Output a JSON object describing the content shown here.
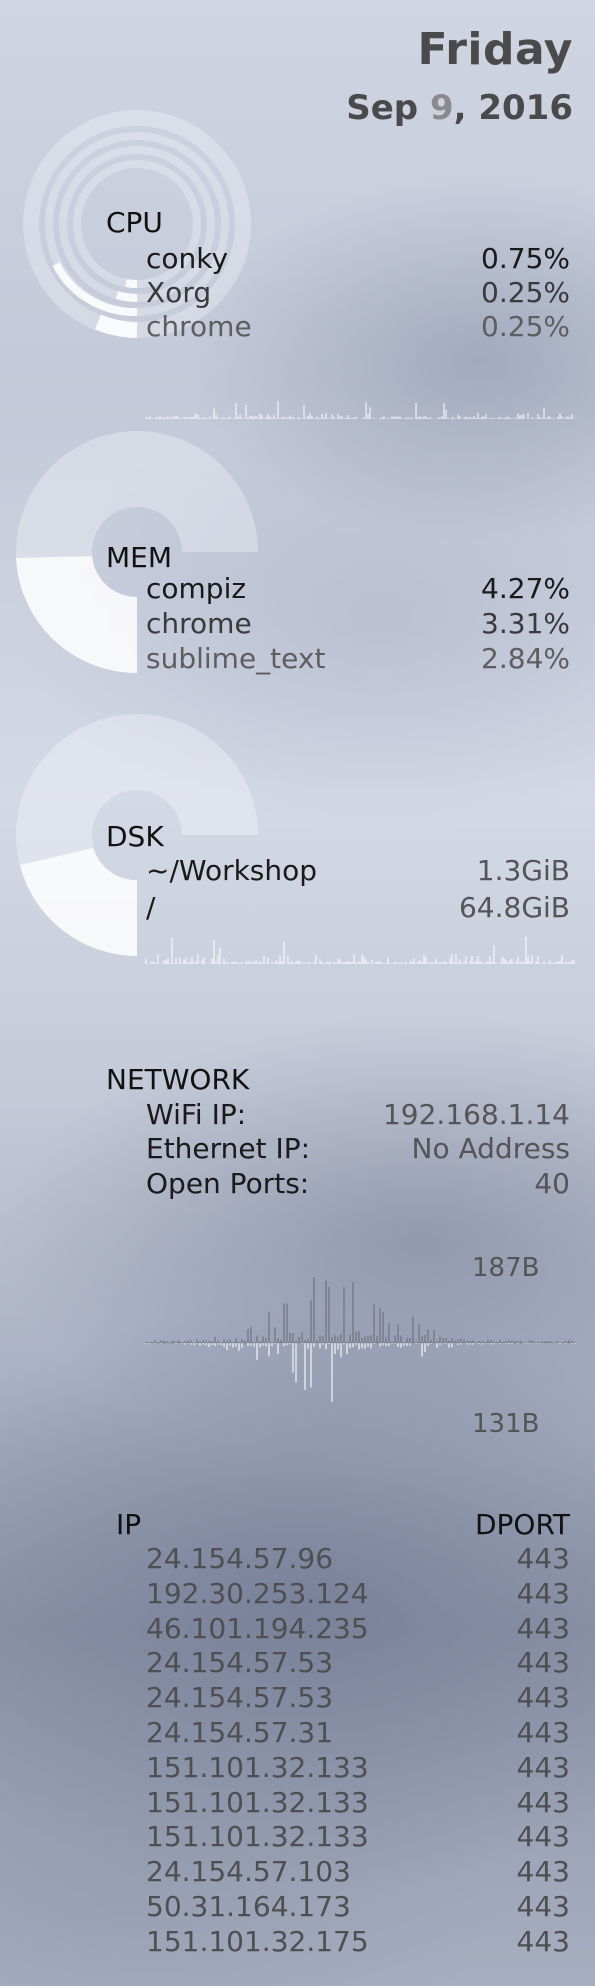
{
  "date": {
    "day": "Friday",
    "month": "Sep",
    "day_num": "9",
    "year_suffix": ", 2016"
  },
  "cpu": {
    "label": "CPU",
    "usage_fraction": 0.0075,
    "processes": [
      {
        "name": "conky",
        "value": "0.75%"
      },
      {
        "name": "Xorg",
        "value": "0.25%"
      },
      {
        "name": "chrome",
        "value": "0.25%"
      }
    ]
  },
  "mem": {
    "label": "MEM",
    "usage_fraction": 0.27,
    "processes": [
      {
        "name": "compiz",
        "value": "4.27%"
      },
      {
        "name": "chrome",
        "value": "3.31%"
      },
      {
        "name": "sublime_text",
        "value": "2.84%"
      }
    ]
  },
  "dsk": {
    "label": "DSK",
    "usage_fraction": 0.31,
    "mounts": [
      {
        "name": "~/Workshop",
        "value": "1.3GiB"
      },
      {
        "name": "/",
        "value": "64.8GiB"
      }
    ]
  },
  "network": {
    "label": "NETWORK",
    "rows": [
      {
        "name": "WiFi IP:",
        "value": "192.168.1.14"
      },
      {
        "name": "Ethernet IP:",
        "value": "No Address"
      },
      {
        "name": "Open Ports:",
        "value": "40"
      }
    ],
    "up_max": "187B",
    "down_max": "131B"
  },
  "connections": {
    "col_ip": "IP",
    "col_dport": "DPORT",
    "rows": [
      {
        "ip": "24.154.57.96",
        "dport": "443"
      },
      {
        "ip": "192.30.253.124",
        "dport": "443"
      },
      {
        "ip": "46.101.194.235",
        "dport": "443"
      },
      {
        "ip": "24.154.57.53",
        "dport": "443"
      },
      {
        "ip": "24.154.57.53",
        "dport": "443"
      },
      {
        "ip": "24.154.57.31",
        "dport": "443"
      },
      {
        "ip": "151.101.32.133",
        "dport": "443"
      },
      {
        "ip": "151.101.32.133",
        "dport": "443"
      },
      {
        "ip": "151.101.32.133",
        "dport": "443"
      },
      {
        "ip": "24.154.57.103",
        "dport": "443"
      },
      {
        "ip": "50.31.164.173",
        "dport": "443"
      },
      {
        "ip": "151.101.32.175",
        "dport": "443"
      }
    ]
  }
}
